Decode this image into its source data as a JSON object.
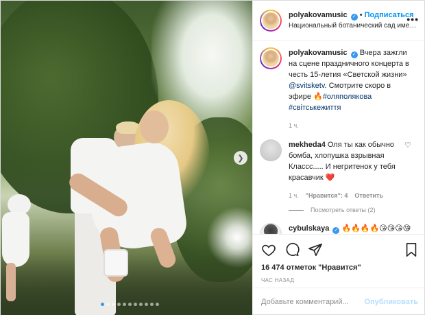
{
  "post": {
    "username": "polyakovamusic",
    "follow_label": "Подписаться",
    "location": "Национальный ботанический сад имени Н...",
    "caption_username": "polyakovamusic",
    "caption_text": "Вчера зажгли на сцене праздничного концерта в честь 15-летия «Светской жизни»",
    "caption_mention": "@svitsketv",
    "caption_tail": ". Смотрите скоро в эфире",
    "caption_emoji": "🔥",
    "caption_hashtags": "#оляполякова #світськежиття",
    "caption_time": "1 ч."
  },
  "comments": [
    {
      "username": "mekheda4",
      "text": "Оля ты как обычно бомба, хлопушка взрывная Классс..... И негритенок у тебя красавчик",
      "emoji": "❤️",
      "time": "1 ч.",
      "likes": "\"Нравится\": 4",
      "reply": "Ответить",
      "view_replies": "Посмотреть ответы (2)"
    },
    {
      "username": "cybulskaya",
      "text": "🔥🔥🔥🔥😘😘😘😘"
    }
  ],
  "actions": {
    "likes": "16 474 отметок \"Нравится\"",
    "time": "ЧАС НАЗАД"
  },
  "add_comment": {
    "placeholder": "Добавьте комментарий...",
    "post_label": "Опубликовать"
  },
  "colors": {
    "accent": "#0095f6",
    "verified": "#3897f0",
    "muted": "#8e8e8e"
  },
  "carousel": {
    "slides": 11,
    "active": 0
  }
}
